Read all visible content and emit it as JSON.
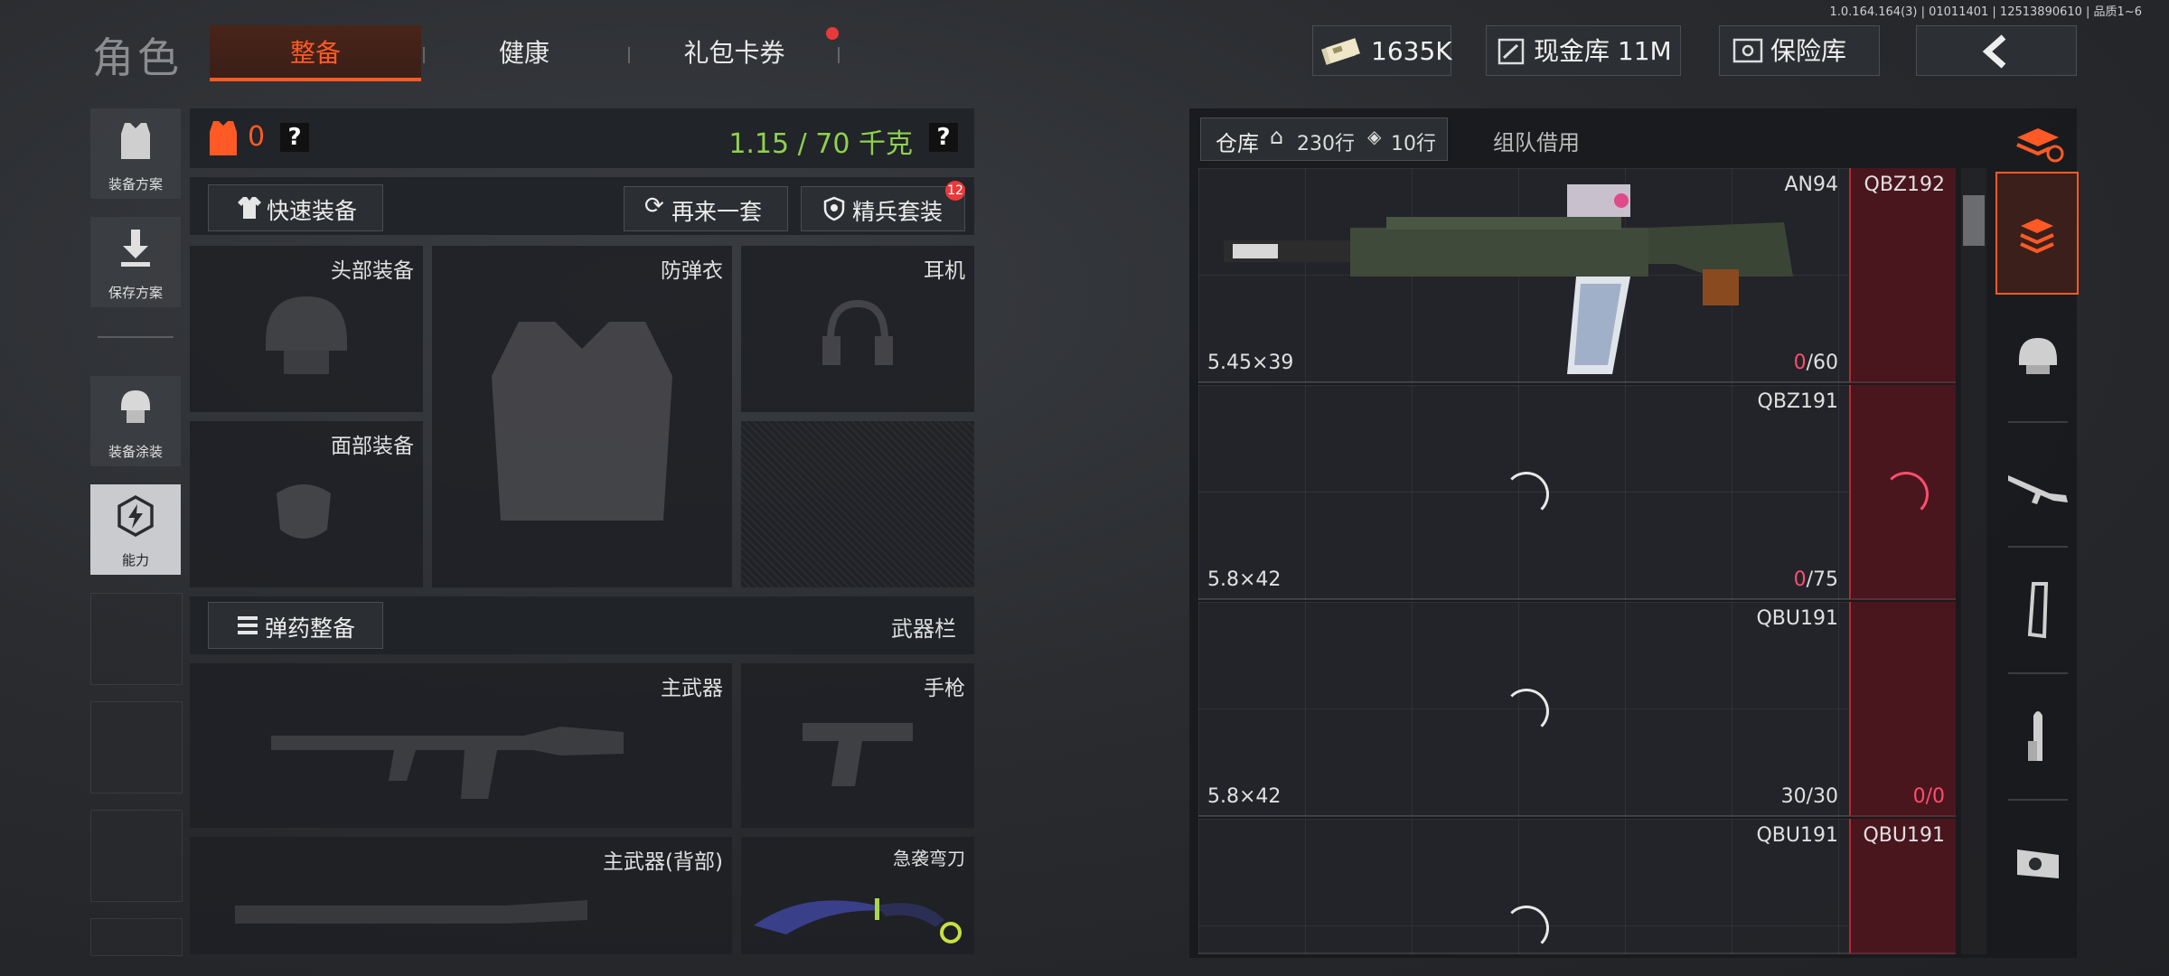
{
  "version_text": "1.0.164.164(3) | 01011401 | 12513890610 | 品质1~6",
  "title": "角色",
  "tabs": {
    "gear": "整备",
    "health": "健康",
    "gift": "礼包卡券"
  },
  "resources": {
    "cash": "1635K",
    "cash_vault": "现金库 11M",
    "safe": "保险库"
  },
  "left_buttons": {
    "plan": "装备方案",
    "save": "保存方案",
    "paint": "装备涂装",
    "ability": "能力"
  },
  "equip": {
    "armor_count": "0",
    "help": "?",
    "weight": "1.15 / 70 千克",
    "quick_equip": "快速装备",
    "again": "再来一套",
    "elite": "精兵套装",
    "elite_badge": "12",
    "slots": {
      "head": "头部装备",
      "vest": "防弹衣",
      "ear": "耳机",
      "face": "面部装备"
    },
    "ammo_btn": "弹药整备",
    "weapon_bar": "武器栏",
    "weapons": {
      "primary": "主武器",
      "pistol": "手枪",
      "primary_back": "主武器(背部)",
      "knife": "急袭弯刀"
    }
  },
  "stash": {
    "tab_storage": "仓库",
    "rows_a": "230行",
    "rows_b": "10行",
    "tab_team": "组队借用",
    "rows": [
      {
        "name": "AN94",
        "caliber": "5.45×39",
        "ammo_cur": "0",
        "ammo_max": "/60",
        "side_name": "QBZ192",
        "side_ammo_cur": "",
        "side_ammo_max": ""
      },
      {
        "name": "QBZ191",
        "caliber": "5.8×42",
        "ammo_cur": "0",
        "ammo_max": "/75",
        "side_name": "",
        "side_ammo_cur": "",
        "side_ammo_max": ""
      },
      {
        "name": "QBU191",
        "caliber": "5.8×42",
        "ammo_cur": "",
        "ammo_max": "30/30",
        "side_name": "",
        "side_ammo_cur": "0",
        "side_ammo_max": "/0"
      },
      {
        "name": "QBU191",
        "caliber": "",
        "ammo_cur": "",
        "ammo_max": "",
        "side_name": "QBU191",
        "side_ammo_cur": "",
        "side_ammo_max": ""
      }
    ]
  },
  "colors": {
    "accent": "#ff5a26",
    "weight_green": "#8fd14f",
    "alert_red": "#ff4d6d"
  }
}
